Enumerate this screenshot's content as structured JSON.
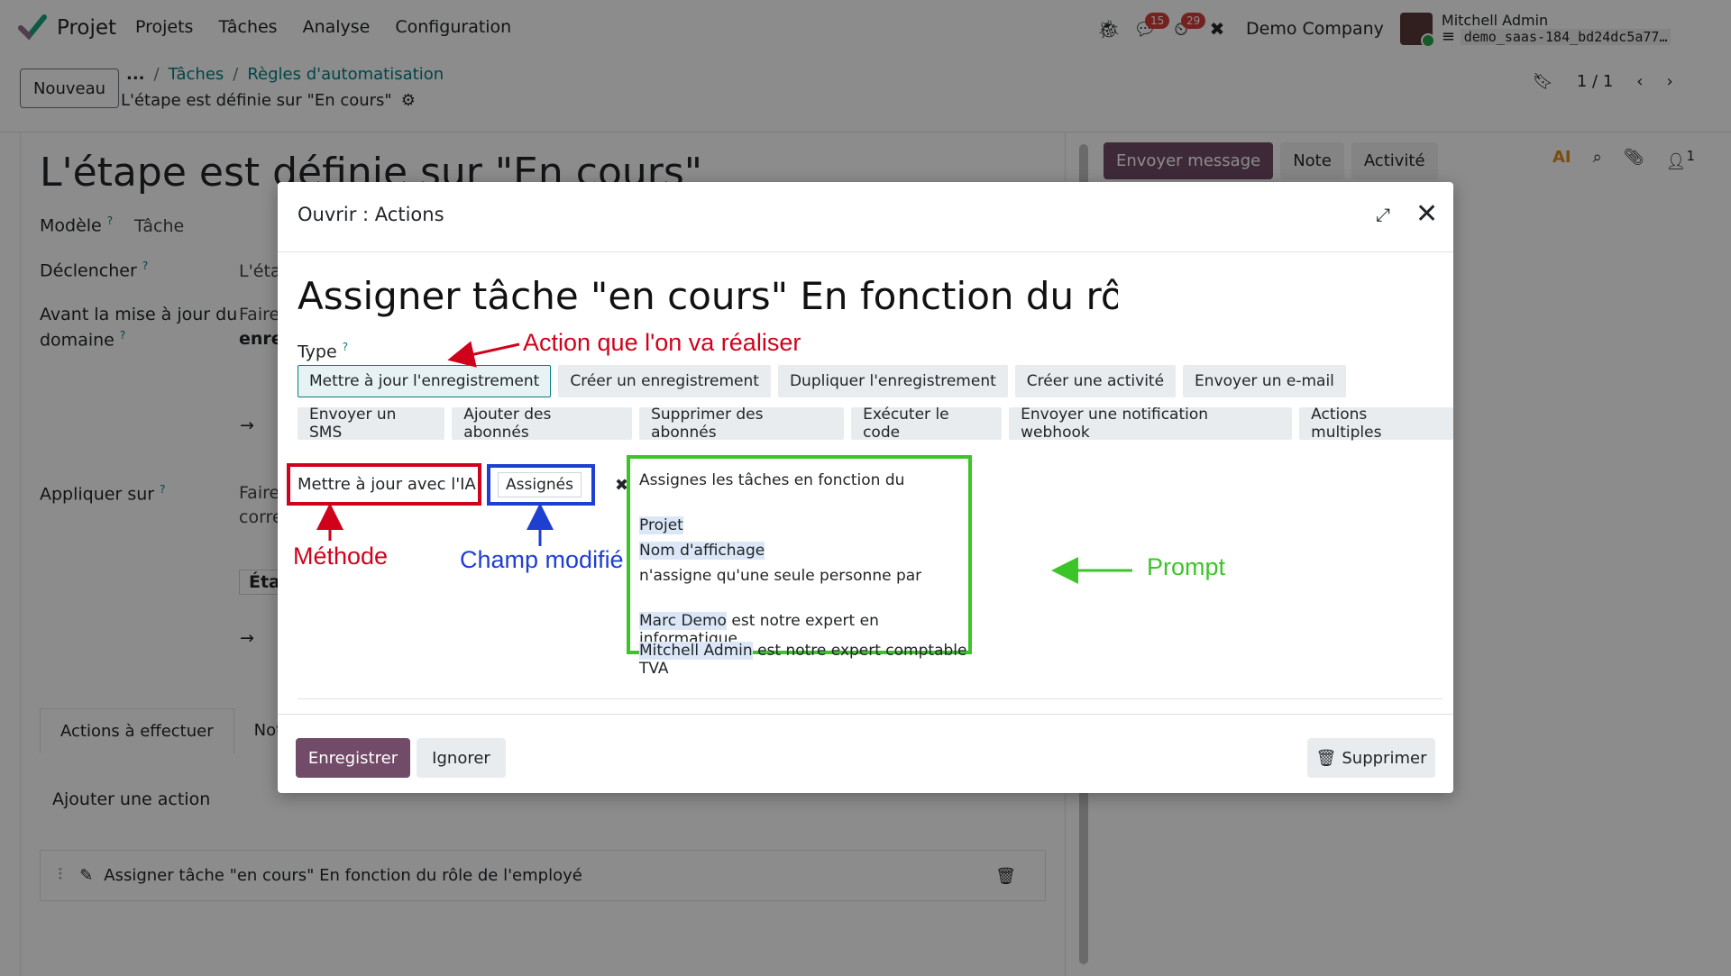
{
  "navbar": {
    "app_name": "Projet",
    "menu": [
      "Projets",
      "Tâches",
      "Analyse",
      "Configuration"
    ],
    "messages_badge": "15",
    "activities_badge": "29",
    "company": "Demo Company",
    "user_name": "Mitchell Admin",
    "database": "demo_saas-184_bd24dc5a77…"
  },
  "control_panel": {
    "new_label": "Nouveau",
    "breadcrumb_dots": "...",
    "breadcrumb": [
      "Tâches",
      "Règles d'automatisation"
    ],
    "breadcrumb_sep": "/",
    "record_title": "L'étape est définie sur \"En cours\"",
    "pager": "1 / 1"
  },
  "form": {
    "title": "L'étape est définie sur \"En cours\"",
    "model_label": "Modèle",
    "model_value": "Tâche",
    "trigger_label": "Déclencher",
    "trigger_value": "L'éta",
    "before_label_1": "Avant la mise à jour du",
    "before_label_2": "domaine",
    "before_value_1": "Faire",
    "before_value_2": "enre",
    "apply_label": "Appliquer sur",
    "apply_value_1": "Faire",
    "apply_value_2": "corre",
    "apply_value_3": "Éta",
    "tabs": [
      "Actions à effectuer",
      "Not"
    ],
    "add_action": "Ajouter une action",
    "action_row": "Assigner tâche \"en cours\" En fonction du rôle de l'employé"
  },
  "chatter": {
    "send_message": "Envoyer message",
    "note": "Note",
    "activity": "Activité",
    "followers": "1"
  },
  "modal": {
    "title": "Ouvrir : Actions",
    "action_name": "Assigner tâche \"en cours\" En fonction du rôle de",
    "type_label": "Type",
    "types_row1": [
      "Mettre à jour l'enregistrement",
      "Créer un enregistrement",
      "Dupliquer l'enregistrement",
      "Créer une activité",
      "Envoyer un e-mail"
    ],
    "types_row2": [
      "Envoyer un SMS",
      "Ajouter des abonnés",
      "Supprimer des abonnés",
      "Exécuter le code",
      "Envoyer une notification webhook",
      "Actions multiples"
    ],
    "method_value": "Mettre à jour avec l'IA",
    "field_value": "Assignés",
    "prompt_lines": {
      "l1": "Assignes les tâches en fonction du",
      "l2": "Projet",
      "l3": "Nom d'affichage",
      "l4": "n'assigne qu'une  seule personne par",
      "l5a": "Marc Demo",
      "l5b": " est notre expert en informatique",
      "l6a": "Mitchell Admin",
      "l6b": " est notre expert comptable TVA"
    },
    "save": "Enregistrer",
    "ignore": "Ignorer",
    "delete": "Supprimer"
  },
  "annotations": {
    "action": "Action que l'on va réaliser",
    "method": "Méthode",
    "field": "Champ modifié",
    "prompt": "Prompt",
    "colors": {
      "red": "#d0021b",
      "blue": "#1f3fd1",
      "green": "#3cc528"
    }
  },
  "colors": {
    "brand": "#714b67",
    "accent": "#017e84"
  }
}
